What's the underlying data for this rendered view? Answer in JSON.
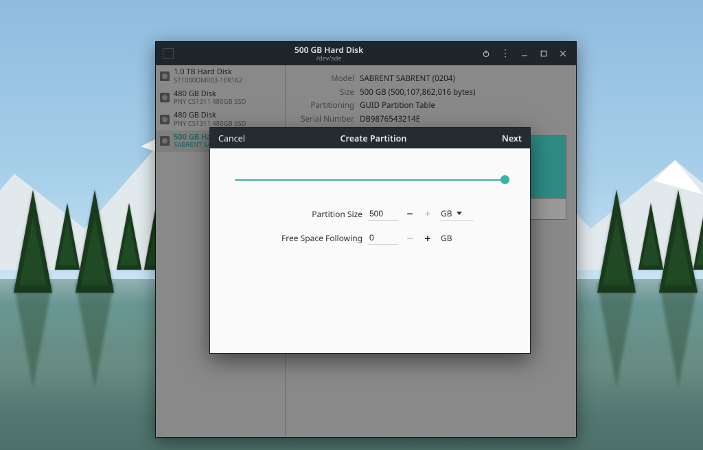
{
  "window": {
    "title": "500 GB Hard Disk",
    "subtitle": "/dev/sde"
  },
  "devices": [
    {
      "name": "1.0 TB Hard Disk",
      "sub": "ST1000DM003-1ER162",
      "selected": false
    },
    {
      "name": "480 GB Disk",
      "sub": "PNY CS1311 480GB SSD",
      "selected": false
    },
    {
      "name": "480 GB Disk",
      "sub": "PNY CS1311 480GB SSD",
      "selected": false
    },
    {
      "name": "500 GB Hard Disk",
      "sub": "SABRENT SABRENT",
      "selected": true
    }
  ],
  "details": {
    "model_label": "Model",
    "model_value": "SABRENT SABRENT (0204)",
    "size_label": "Size",
    "size_value": "500 GB (500,107,862,016 bytes)",
    "part_label": "Partitioning",
    "part_value": "GUID Partition Table",
    "serial_label": "Serial Number",
    "serial_value": "DB9876543214E"
  },
  "dialog": {
    "cancel": "Cancel",
    "title": "Create Partition",
    "next": "Next",
    "size_label": "Partition Size",
    "size_value": "500",
    "size_unit": "GB",
    "free_label": "Free Space Following",
    "free_value": "0",
    "free_unit": "GB"
  }
}
